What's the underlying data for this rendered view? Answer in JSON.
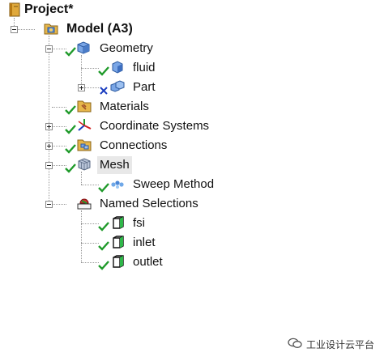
{
  "tree": {
    "project": {
      "label": "Project*",
      "icon": "project-book-icon"
    },
    "model": {
      "label": "Model (A3)",
      "icon": "model-icon"
    },
    "geometry": {
      "label": "Geometry",
      "icon": "geometry-cube-icon",
      "status": "ok"
    },
    "fluid": {
      "label": "fluid",
      "icon": "body-icon",
      "status": "ok"
    },
    "part": {
      "label": "Part",
      "icon": "part-icon",
      "status": "suppressed"
    },
    "materials": {
      "label": "Materials",
      "icon": "materials-folder-icon",
      "status": "ok"
    },
    "coordinate_systems": {
      "label": "Coordinate Systems",
      "icon": "coordinate-axes-icon",
      "status": "ok"
    },
    "connections": {
      "label": "Connections",
      "icon": "connections-folder-icon",
      "status": "ok"
    },
    "mesh": {
      "label": "Mesh",
      "icon": "mesh-icon",
      "status": "ok"
    },
    "sweep_method": {
      "label": "Sweep Method",
      "icon": "sweep-method-icon",
      "status": "ok"
    },
    "named_selections": {
      "label": "Named Selections",
      "icon": "named-selections-icon"
    },
    "fsi": {
      "label": "fsi",
      "icon": "selection-icon",
      "status": "ok"
    },
    "inlet": {
      "label": "inlet",
      "icon": "selection-icon",
      "status": "ok"
    },
    "outlet": {
      "label": "outlet",
      "icon": "selection-icon",
      "status": "ok"
    }
  },
  "watermark": {
    "text": "工业设计云平台",
    "icon": "wechat-logo-icon"
  },
  "colors": {
    "check": "#1f9a2a",
    "cross": "#1a3dbf",
    "folder": "#e6b64a",
    "cube": "#5b8fd6"
  }
}
